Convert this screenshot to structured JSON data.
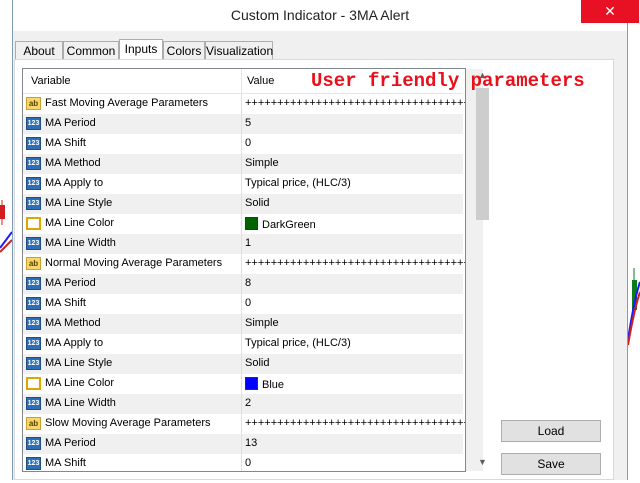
{
  "window": {
    "title": "Custom Indicator - 3MA Alert",
    "close_glyph": "✕"
  },
  "tabs": [
    {
      "label": "About"
    },
    {
      "label": "Common"
    },
    {
      "label": "Inputs",
      "active": true
    },
    {
      "label": "Colors"
    },
    {
      "label": "Visualization"
    }
  ],
  "grid": {
    "header_variable": "Variable",
    "header_value": "Value",
    "rows": [
      {
        "icon": "ab",
        "kind": "text-icon",
        "variable": "Fast Moving Average Parameters",
        "value": "++++++++++++++++++++++++++++++++++++++"
      },
      {
        "icon": "123",
        "kind": "number-icon",
        "variable": "MA Period",
        "value": "5"
      },
      {
        "icon": "123",
        "kind": "number-icon",
        "variable": "MA Shift",
        "value": "0"
      },
      {
        "icon": "123",
        "kind": "number-icon",
        "variable": "MA Method",
        "value": "Simple"
      },
      {
        "icon": "123",
        "kind": "number-icon",
        "variable": "MA Apply to",
        "value": "Typical price, (HLC/3)"
      },
      {
        "icon": "123",
        "kind": "number-icon",
        "variable": "MA Line Style",
        "value": "Solid"
      },
      {
        "icon": "",
        "kind": "color-icon",
        "variable": "MA Line Color",
        "value": "DarkGreen",
        "swatch": "#006400"
      },
      {
        "icon": "123",
        "kind": "number-icon",
        "variable": "MA Line Width",
        "value": "1"
      },
      {
        "icon": "ab",
        "kind": "text-icon",
        "variable": "Normal Moving Average Parameters",
        "value": "++++++++++++++++++++++++++++++++++++++"
      },
      {
        "icon": "123",
        "kind": "number-icon",
        "variable": "MA Period",
        "value": "8"
      },
      {
        "icon": "123",
        "kind": "number-icon",
        "variable": "MA Shift",
        "value": "0"
      },
      {
        "icon": "123",
        "kind": "number-icon",
        "variable": "MA Method",
        "value": "Simple"
      },
      {
        "icon": "123",
        "kind": "number-icon",
        "variable": "MA Apply to",
        "value": "Typical price, (HLC/3)"
      },
      {
        "icon": "123",
        "kind": "number-icon",
        "variable": "MA Line Style",
        "value": "Solid"
      },
      {
        "icon": "",
        "kind": "color-icon",
        "variable": "MA Line Color",
        "value": "Blue",
        "swatch": "#0000ff"
      },
      {
        "icon": "123",
        "kind": "number-icon",
        "variable": "MA Line Width",
        "value": "2"
      },
      {
        "icon": "ab",
        "kind": "text-icon",
        "variable": "Slow Moving Average Parameters",
        "value": "++++++++++++++++++++++++++++++++++++++"
      },
      {
        "icon": "123",
        "kind": "number-icon",
        "variable": "MA Period",
        "value": "13"
      },
      {
        "icon": "123",
        "kind": "number-icon",
        "variable": "MA Shift",
        "value": "0"
      }
    ]
  },
  "annotation": "User friendly parameters",
  "buttons": {
    "load": "Load",
    "save": "Save"
  },
  "scroll": {
    "up_glyph": "▲",
    "down_glyph": "▼"
  },
  "colors": {
    "annotation": "#e8101a",
    "close": "#e81123"
  }
}
